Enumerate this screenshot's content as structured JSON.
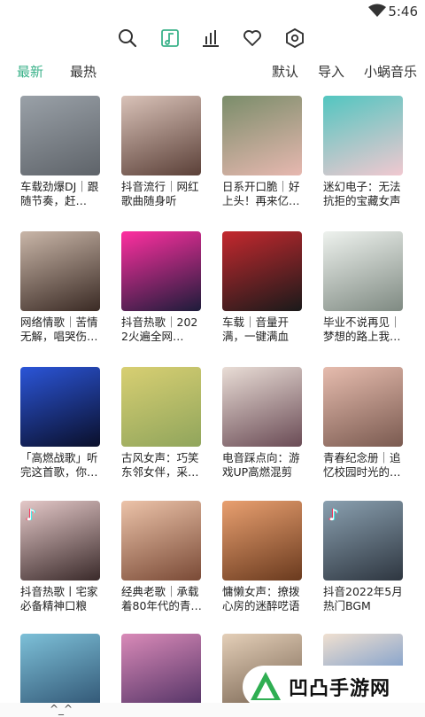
{
  "status": {
    "time": "5:46"
  },
  "toolbar": {
    "icons": [
      "search-icon",
      "music-note-icon",
      "chart-icon",
      "heart-icon",
      "hexagon-icon"
    ],
    "accent": "#3bb28a"
  },
  "tabs": {
    "latest": "最新",
    "hottest": "最热",
    "default": "默认",
    "import": "导入",
    "brand": "小蜗音乐"
  },
  "playlists": [
    {
      "title": "车载劲爆DJ｜跟随节奏，赶…",
      "colors": [
        "#9aa1a8",
        "#5e6369"
      ]
    },
    {
      "title": "抖音流行｜网红歌曲随身听",
      "colors": [
        "#d9c2b8",
        "#5b4038"
      ]
    },
    {
      "title": "日系开口脆｜好上头！再来亿…",
      "colors": [
        "#7a8d6a",
        "#e7b8b0"
      ]
    },
    {
      "title": "迷幻电子：无法抗拒的宝藏女声",
      "colors": [
        "#52c6c0",
        "#f1c8d0"
      ]
    },
    {
      "title": "网络情歌｜苦情无解，唱哭伤…",
      "colors": [
        "#c9b6a8",
        "#3a2a24"
      ]
    },
    {
      "title": "抖音热歌｜2022火遍全网…",
      "colors": [
        "#ff2fa0",
        "#1d1c3a"
      ]
    },
    {
      "title": "车载｜音量开满，一键满血",
      "colors": [
        "#c4282e",
        "#1a1a1a"
      ]
    },
    {
      "title": "毕业不说再见｜梦想的路上我…",
      "colors": [
        "#eef2ee",
        "#7f8a82"
      ]
    },
    {
      "title": "「高燃战歌」听完这首歌，你…",
      "colors": [
        "#2b55d8",
        "#0a0f2a"
      ]
    },
    {
      "title": "古风女声：巧笑东邻女伴，采…",
      "colors": [
        "#d8cf72",
        "#90a55c"
      ]
    },
    {
      "title": "电音踩点向：游戏UP高燃混剪",
      "colors": [
        "#e9ddd6",
        "#6a4b55"
      ]
    },
    {
      "title": "青春纪念册｜追忆校园时光的…",
      "colors": [
        "#e6bcae",
        "#7a5a50"
      ]
    },
    {
      "title": "抖音热歌丨宅家必备精神口粮",
      "colors": [
        "#e4c8c8",
        "#3a2a2a"
      ],
      "tiktok": true
    },
    {
      "title": "经典老歌｜承载着80年代的青…",
      "colors": [
        "#ecc3a9",
        "#7a4a36"
      ]
    },
    {
      "title": "慵懒女声：撩拨心房的迷醉呓语",
      "colors": [
        "#e9a070",
        "#6a3a1e"
      ]
    },
    {
      "title": "抖音2022年5月热门BGM",
      "colors": [
        "#8aa0b0",
        "#2e3640"
      ],
      "tiktok": true
    },
    {
      "title": "",
      "colors": [
        "#7dc0d8",
        "#2c4f6e"
      ]
    },
    {
      "title": "",
      "colors": [
        "#d98ab8",
        "#4a2d60"
      ]
    },
    {
      "title": "",
      "colors": [
        "#e4cfb8",
        "#6e5a48"
      ]
    },
    {
      "title": "",
      "colors": [
        "#f0e0d0",
        "#3b78c9"
      ]
    }
  ],
  "watermark": {
    "text": "凹凸手游网"
  },
  "bottom": {
    "handle": "^_^"
  }
}
